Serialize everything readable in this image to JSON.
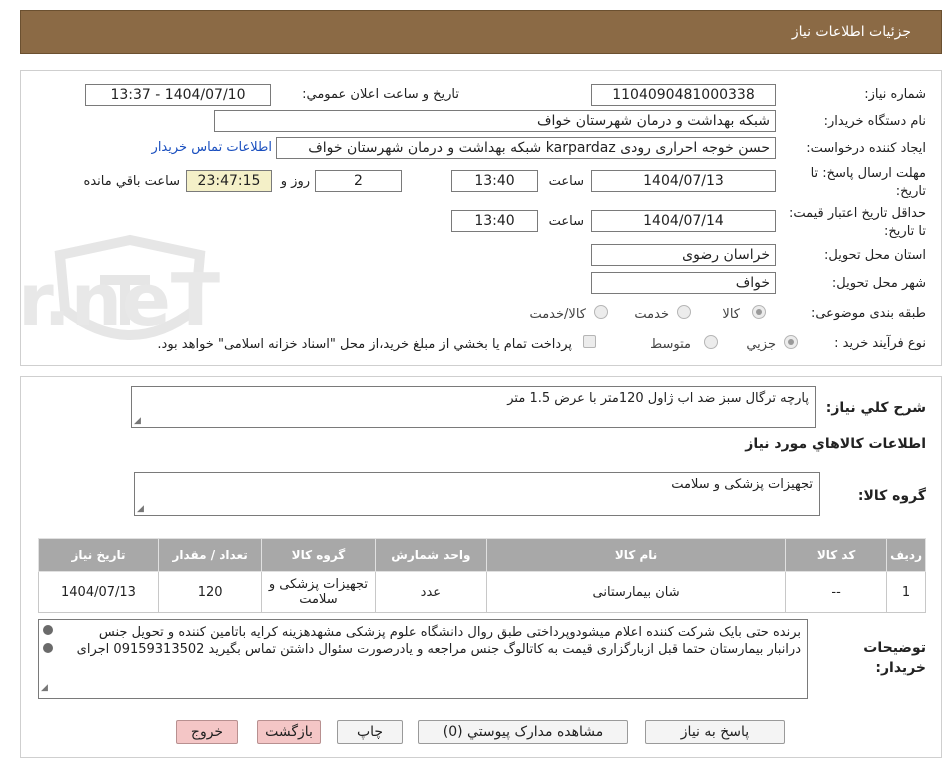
{
  "header": {
    "title": "جزئیات اطلاعات نیاز"
  },
  "form": {
    "need_number": {
      "label": "شماره نیاز:",
      "value": "1104090481000338"
    },
    "announce": {
      "label": "تاریخ و ساعت اعلان عمومي:",
      "value": "1404/07/10 - 13:37"
    },
    "buyer": {
      "label": "نام دستگاه خريدار:",
      "value": "شبکه بهداشت و درمان شهرستان خواف"
    },
    "creator": {
      "label": "ايجاد کننده درخواست:",
      "value": "حسن خوجه احراری رودی karpardaz شبکه بهداشت و درمان شهرستان خواف",
      "contact_link": "اطلاعات تماس خريدار"
    },
    "deadline": {
      "label": "مهلت ارسال پاسخ: تا تاريخ:",
      "date": "1404/07/13",
      "time_label": "ساعت",
      "time": "13:40",
      "days": "2",
      "days_label": "روز و",
      "remaining": "23:47:15",
      "remaining_label": "ساعت باقي مانده"
    },
    "validity": {
      "label": "حداقل تاريخ اعتبار قيمت: تا تاريخ:",
      "date": "1404/07/14",
      "time_label": "ساعت",
      "time": "13:40"
    },
    "province": {
      "label": "استان محل تحويل:",
      "value": "خراسان رضوی"
    },
    "city": {
      "label": "شهر محل تحويل:",
      "value": "خواف"
    },
    "category": {
      "label": "طبقه بندی موضوعی:",
      "options": [
        "کالا",
        "خدمت",
        "کالا/خدمت"
      ]
    },
    "process": {
      "label": "نوع فرآيند خريد :",
      "options": [
        "جزيي",
        "متوسط"
      ],
      "note": "پرداخت تمام يا بخشي از مبلغ خريد،از محل \"اسناد خزانه اسلامی\" خواهد بود."
    }
  },
  "summary": {
    "label": "شرح کلي نياز:",
    "value": "پارچه ترگال سبز ضد اب ژاول 120متر با عرض  1.5 متر"
  },
  "goods_section": {
    "title": "اطلاعات کالاهاي مورد نياز"
  },
  "goods_group": {
    "label": "گروه کالا:",
    "value": "تجهيزات پزشکی و سلامت"
  },
  "table": {
    "headers": [
      "رديف",
      "کد کالا",
      "نام کالا",
      "واحد شمارش",
      "گروه کالا",
      "تعداد / مقدار",
      "تاريخ نياز"
    ],
    "rows": [
      [
        "1",
        "--",
        "شان بیمارستانی",
        "عدد",
        "تجهيزات پزشکی و سلامت",
        "120",
        "1404/07/13"
      ]
    ]
  },
  "buyer_notes": {
    "label": "توضيحات خريدار:",
    "value": "برنده حتی بایک شرکت کننده اعلام میشودوپرداختی طبق روال دانشگاه علوم پزشکی مشهدهزینه کرایه باتامین کننده و تحویل جنس درانبار بیمارستان  حتما قبل ازبارگزاری قیمت به کاتالوگ جنس مراجعه و یادرصورت سئوال داشتن تماس بگیرید 09159313502 اجرای"
  },
  "buttons": {
    "reply": "پاسخ به نياز",
    "attachments": "مشاهده مدارک پيوستي (0)",
    "print": "چاپ",
    "back": "بازگشت",
    "exit": "خروج"
  },
  "watermark": {
    "text": "AriaTender.neT"
  },
  "colors": {
    "header_bg": "#8b6a45",
    "timer_bg": "#f4f0c8",
    "exit_bg": "#f4c6c6",
    "link": "#1a4fbf"
  }
}
